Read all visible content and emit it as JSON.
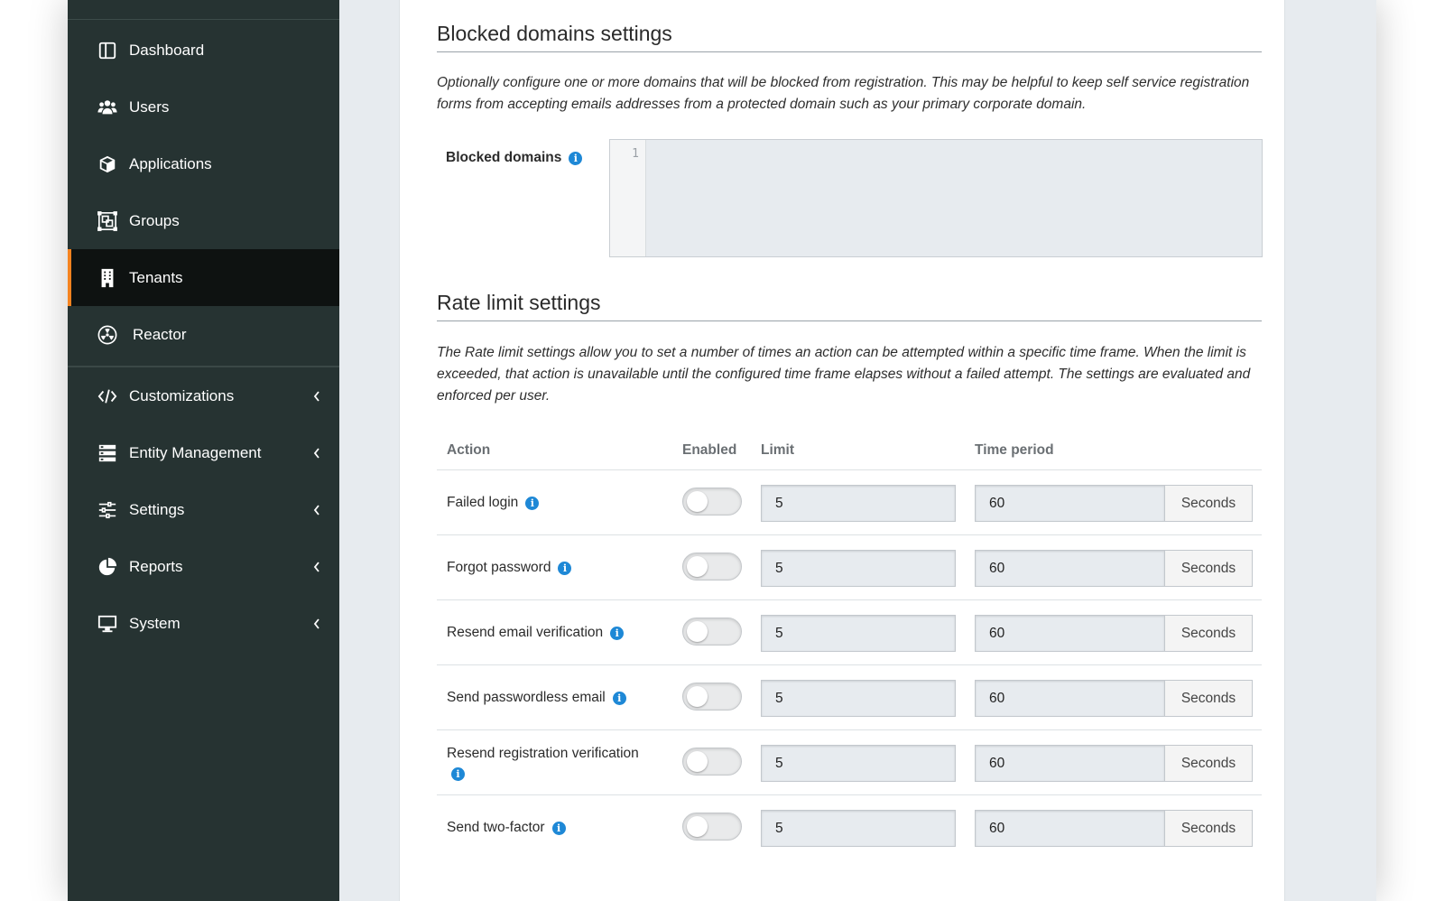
{
  "sidebar": {
    "items": [
      {
        "label": "Dashboard",
        "icon": "dashboard-icon"
      },
      {
        "label": "Users",
        "icon": "users-icon"
      },
      {
        "label": "Applications",
        "icon": "cube-icon"
      },
      {
        "label": "Groups",
        "icon": "groups-icon"
      },
      {
        "label": "Tenants",
        "icon": "building-icon",
        "active": true
      },
      {
        "label": "Reactor",
        "icon": "radiation-icon"
      },
      {
        "label": "Customizations",
        "icon": "code-icon",
        "expandable": true
      },
      {
        "label": "Entity Management",
        "icon": "server-icon",
        "expandable": true
      },
      {
        "label": "Settings",
        "icon": "sliders-icon",
        "expandable": true
      },
      {
        "label": "Reports",
        "icon": "pie-chart-icon",
        "expandable": true
      },
      {
        "label": "System",
        "icon": "monitor-icon",
        "expandable": true
      }
    ]
  },
  "blocked": {
    "title": "Blocked domains settings",
    "description": "Optionally configure one or more domains that will be blocked from registration. This may be helpful to keep self service registration forms from accepting emails addresses from a protected domain such as your primary corporate domain.",
    "label": "Blocked domains",
    "line_number": "1",
    "value": ""
  },
  "rate": {
    "title": "Rate limit settings",
    "description": "The Rate limit settings allow you to set a number of times an action can be attempted within a specific time frame. When the limit is exceeded, that action is unavailable until the configured time frame elapses without a failed attempt. The settings are evaluated and enforced per user.",
    "columns": {
      "action": "Action",
      "enabled": "Enabled",
      "limit": "Limit",
      "period": "Time period"
    },
    "rows": [
      {
        "action": "Failed login",
        "enabled": false,
        "limit": "5",
        "period": "60",
        "unit": "Seconds"
      },
      {
        "action": "Forgot password",
        "enabled": false,
        "limit": "5",
        "period": "60",
        "unit": "Seconds"
      },
      {
        "action": "Resend email verification",
        "enabled": false,
        "limit": "5",
        "period": "60",
        "unit": "Seconds"
      },
      {
        "action": "Send passwordless email",
        "enabled": false,
        "limit": "5",
        "period": "60",
        "unit": "Seconds"
      },
      {
        "action": "Resend registration verification",
        "enabled": false,
        "limit": "5",
        "period": "60",
        "unit": "Seconds"
      },
      {
        "action": "Send two-factor",
        "enabled": false,
        "limit": "5",
        "period": "60",
        "unit": "Seconds"
      }
    ]
  },
  "colors": {
    "sidebar_bg": "#263332",
    "sidebar_active_bg": "#0e1211",
    "accent": "#f58320",
    "info": "#1e88d6"
  }
}
